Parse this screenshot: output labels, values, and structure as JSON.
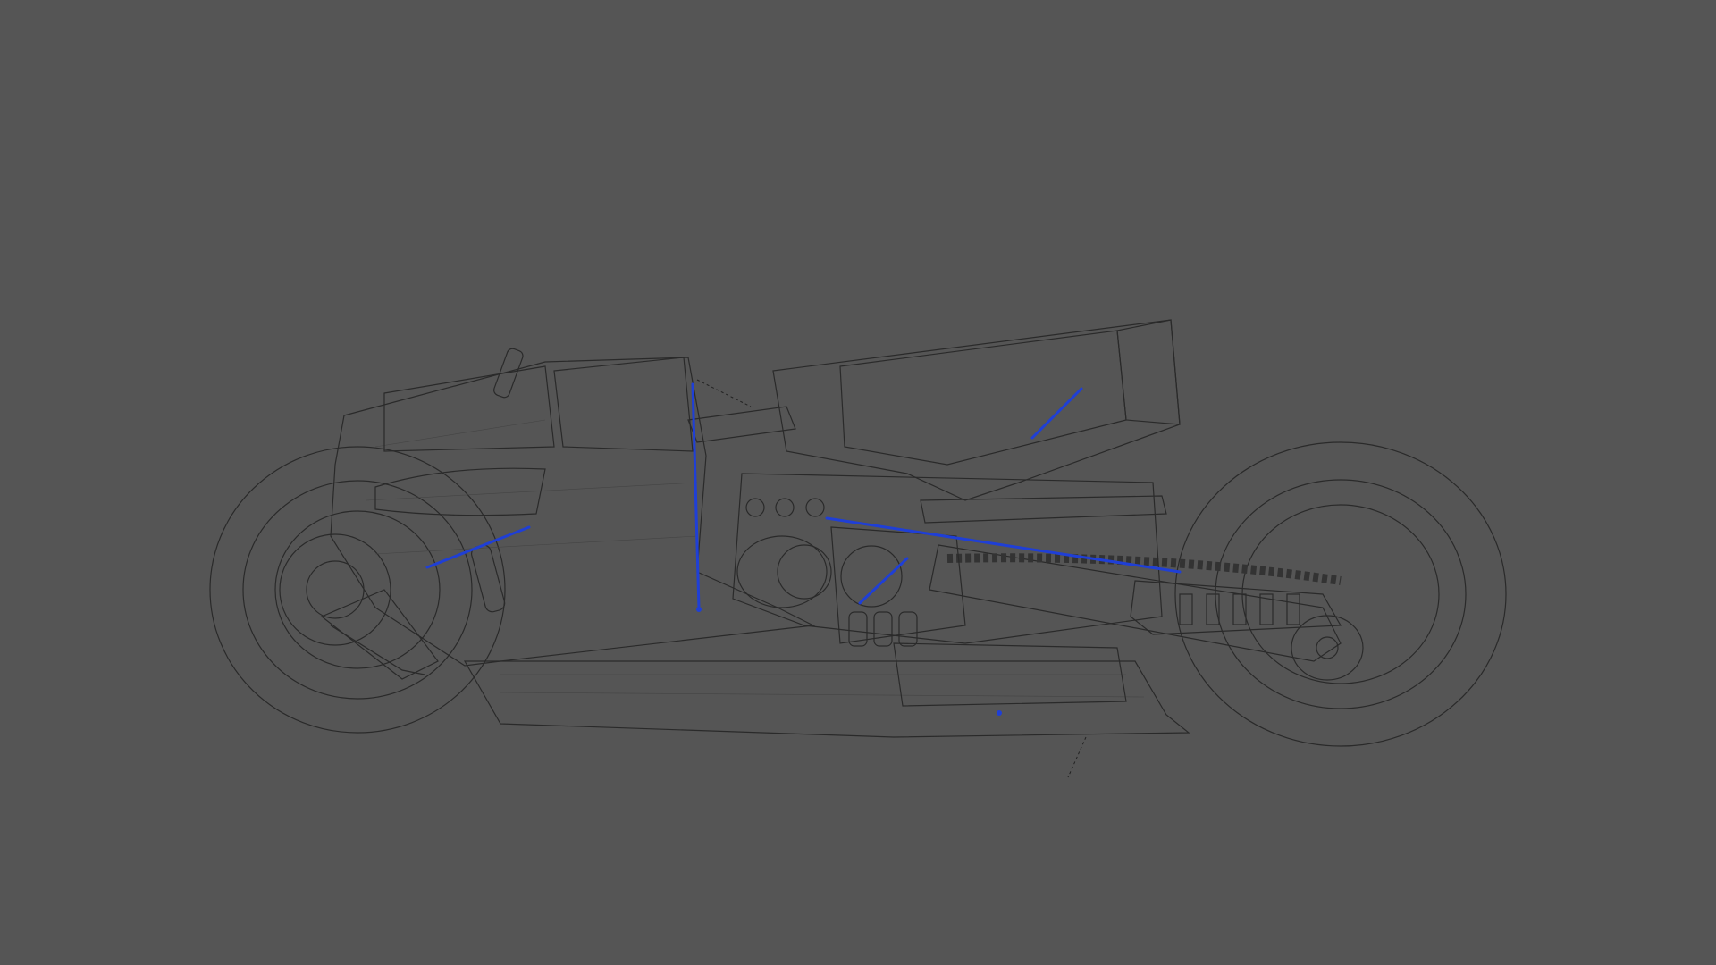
{
  "viewport": {
    "background_color": "#555555",
    "mesh_color": "#cfcfcf",
    "wire_color": "#2a2a2a",
    "bone_color": "#1f3fd6",
    "display_mode": "wireframe-on-shaded"
  },
  "scene": {
    "object": "motorcycle",
    "parts": [
      "front-wheel",
      "rear-wheel",
      "fuel-tank-fairing",
      "seat",
      "engine",
      "chain",
      "swingarm",
      "exhaust",
      "front-fork",
      "belly-pan"
    ]
  }
}
